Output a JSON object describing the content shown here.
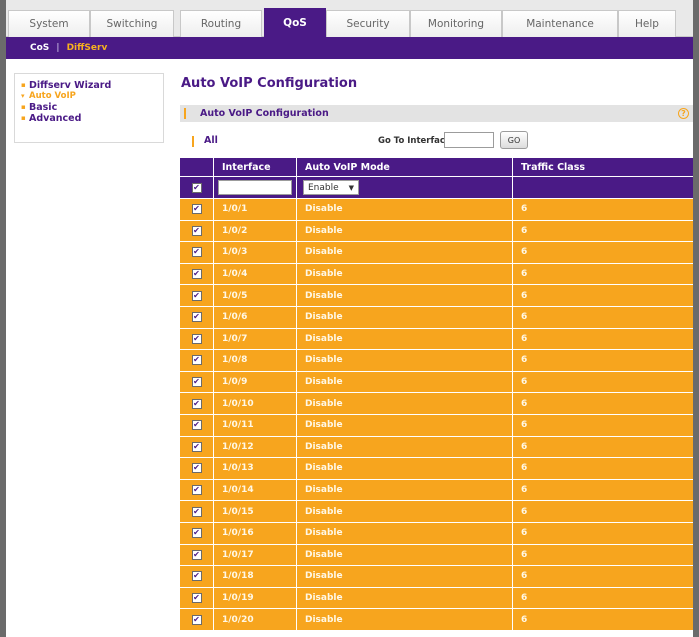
{
  "tabs": [
    {
      "label": "System",
      "active": false
    },
    {
      "label": "Switching",
      "active": false
    },
    {
      "label": "Routing",
      "active": false
    },
    {
      "label": "QoS",
      "active": true
    },
    {
      "label": "Security",
      "active": false
    },
    {
      "label": "Monitoring",
      "active": false
    },
    {
      "label": "Maintenance",
      "active": false
    },
    {
      "label": "Help",
      "active": false
    }
  ],
  "subnav": {
    "cos": "CoS",
    "separator": "|",
    "diffserv": "DiffServ"
  },
  "sidebar": {
    "items": [
      {
        "label": "Diffserv Wizard",
        "marker": "▪",
        "sub": false
      },
      {
        "label": "Auto VoIP",
        "marker": "▾",
        "sub": true
      },
      {
        "label": "Basic",
        "marker": "▪",
        "sub": false
      },
      {
        "label": "Advanced",
        "marker": "▪",
        "sub": false
      }
    ]
  },
  "page": {
    "title": "Auto VoIP Configuration"
  },
  "panel": {
    "title": "Auto VoIP Configuration",
    "help_icon": "?"
  },
  "toolbar": {
    "all_label": "All",
    "goto_label": "Go To Interface",
    "goto_value": "",
    "go_button": "GO"
  },
  "table": {
    "headers": {
      "interface": "Interface",
      "mode": "Auto VoIP Mode",
      "traffic_class": "Traffic Class"
    },
    "filter": {
      "checkbox": "✔",
      "interface_value": "",
      "mode_value": "Enable",
      "mode_arrow": "▼"
    },
    "rows": [
      {
        "check": "✔",
        "interface": "1/0/1",
        "mode": "Disable",
        "tc": "6"
      },
      {
        "check": "✔",
        "interface": "1/0/2",
        "mode": "Disable",
        "tc": "6"
      },
      {
        "check": "✔",
        "interface": "1/0/3",
        "mode": "Disable",
        "tc": "6"
      },
      {
        "check": "✔",
        "interface": "1/0/4",
        "mode": "Disable",
        "tc": "6"
      },
      {
        "check": "✔",
        "interface": "1/0/5",
        "mode": "Disable",
        "tc": "6"
      },
      {
        "check": "✔",
        "interface": "1/0/6",
        "mode": "Disable",
        "tc": "6"
      },
      {
        "check": "✔",
        "interface": "1/0/7",
        "mode": "Disable",
        "tc": "6"
      },
      {
        "check": "✔",
        "interface": "1/0/8",
        "mode": "Disable",
        "tc": "6"
      },
      {
        "check": "✔",
        "interface": "1/0/9",
        "mode": "Disable",
        "tc": "6"
      },
      {
        "check": "✔",
        "interface": "1/0/10",
        "mode": "Disable",
        "tc": "6"
      },
      {
        "check": "✔",
        "interface": "1/0/11",
        "mode": "Disable",
        "tc": "6"
      },
      {
        "check": "✔",
        "interface": "1/0/12",
        "mode": "Disable",
        "tc": "6"
      },
      {
        "check": "✔",
        "interface": "1/0/13",
        "mode": "Disable",
        "tc": "6"
      },
      {
        "check": "✔",
        "interface": "1/0/14",
        "mode": "Disable",
        "tc": "6"
      },
      {
        "check": "✔",
        "interface": "1/0/15",
        "mode": "Disable",
        "tc": "6"
      },
      {
        "check": "✔",
        "interface": "1/0/16",
        "mode": "Disable",
        "tc": "6"
      },
      {
        "check": "✔",
        "interface": "1/0/17",
        "mode": "Disable",
        "tc": "6"
      },
      {
        "check": "✔",
        "interface": "1/0/18",
        "mode": "Disable",
        "tc": "6"
      },
      {
        "check": "✔",
        "interface": "1/0/19",
        "mode": "Disable",
        "tc": "6"
      },
      {
        "check": "✔",
        "interface": "1/0/20",
        "mode": "Disable",
        "tc": "6"
      }
    ]
  },
  "colors": {
    "brand_purple": "#4a1a86",
    "accent_orange": "#f7a51e"
  }
}
